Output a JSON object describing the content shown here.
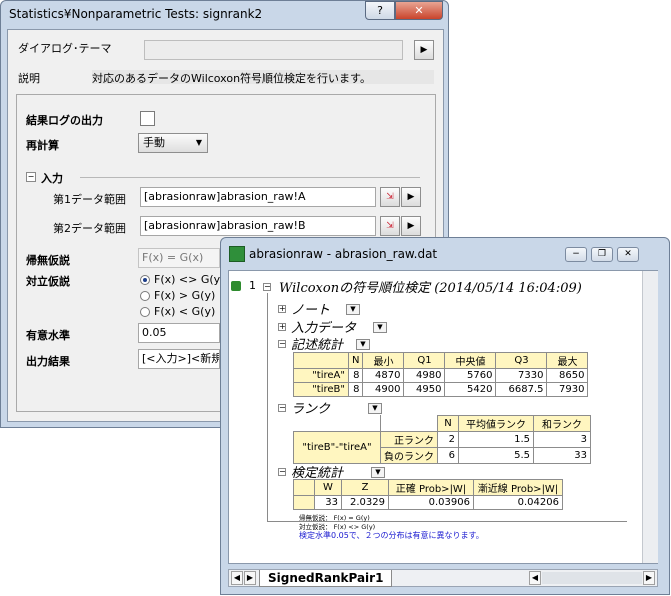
{
  "dialog": {
    "title": "Statistics¥Nonparametric Tests: signrank2",
    "help_label": "?",
    "close_label": "✕",
    "theme_label": "ダイアログ･テーマ",
    "theme_value": "",
    "description_label": "説明",
    "description_text": "対応のあるデータのWilcoxon符号順位検定を行います。",
    "log_output_label": "結果ログの出力",
    "recalc_label": "再計算",
    "recalc_value": "手動",
    "input_section_label": "入力",
    "range1_label": "第1データ範囲",
    "range1_value": "[abrasionraw]abrasion_raw!A",
    "range2_label": "第2データ範囲",
    "range2_value": "[abrasionraw]abrasion_raw!B",
    "null_hyp_label": "帰無仮説",
    "null_hyp_value": "F(x) = G(x)",
    "alt_hyp_label": "対立仮説",
    "alt_options": [
      "F(x) <> G(y)",
      "F(x) > G(y)",
      "F(x) < G(y)"
    ],
    "alt_selected_index": 0,
    "sig_level_label": "有意水準",
    "sig_level_value": "0.05",
    "output_label": "出力結果",
    "output_value": "[<入力>]<新規"
  },
  "workbook": {
    "title": "abrasionraw - abrasion_raw.dat",
    "row_number": "1",
    "report_title": "Wilcoxonの符号順位検定 (2014/05/14 16:04:09)",
    "notes_label": "ノート",
    "input_data_label": "入力データ",
    "desc_stats_label": "記述統計",
    "desc_headers": [
      "",
      "N",
      "最小",
      "Q1",
      "中央値",
      "Q3",
      "最大"
    ],
    "desc_rows": [
      [
        "\"tireA\"",
        "8",
        "4870",
        "4980",
        "5760",
        "7330",
        "8650"
      ],
      [
        "\"tireB\"",
        "8",
        "4900",
        "4950",
        "5420",
        "6687.5",
        "7930"
      ]
    ],
    "rank_label": "ランク",
    "rank_headers": [
      "",
      "",
      "N",
      "平均値ランク",
      "和ランク"
    ],
    "rank_group": "\"tireB\"-\"tireA\"",
    "rank_rows": [
      [
        "正ランク",
        "2",
        "1.5",
        "3"
      ],
      [
        "負のランク",
        "6",
        "5.5",
        "33"
      ]
    ],
    "test_stats_label": "検定統計",
    "test_headers": [
      "",
      "W",
      "Z",
      "正確 Prob>|W|",
      "漸近線 Prob>|W|"
    ],
    "test_row": [
      "",
      "33",
      "2.0329",
      "0.03906",
      "0.04206"
    ],
    "null_note": "帰無仮説： F(x) = G(y)",
    "alt_note": "対立仮説： F(x) <> G(y)",
    "conclusion": "検定水準0.05で、２つの分布は有意に異なります。",
    "sheet_tab": "SignedRankPair1"
  }
}
